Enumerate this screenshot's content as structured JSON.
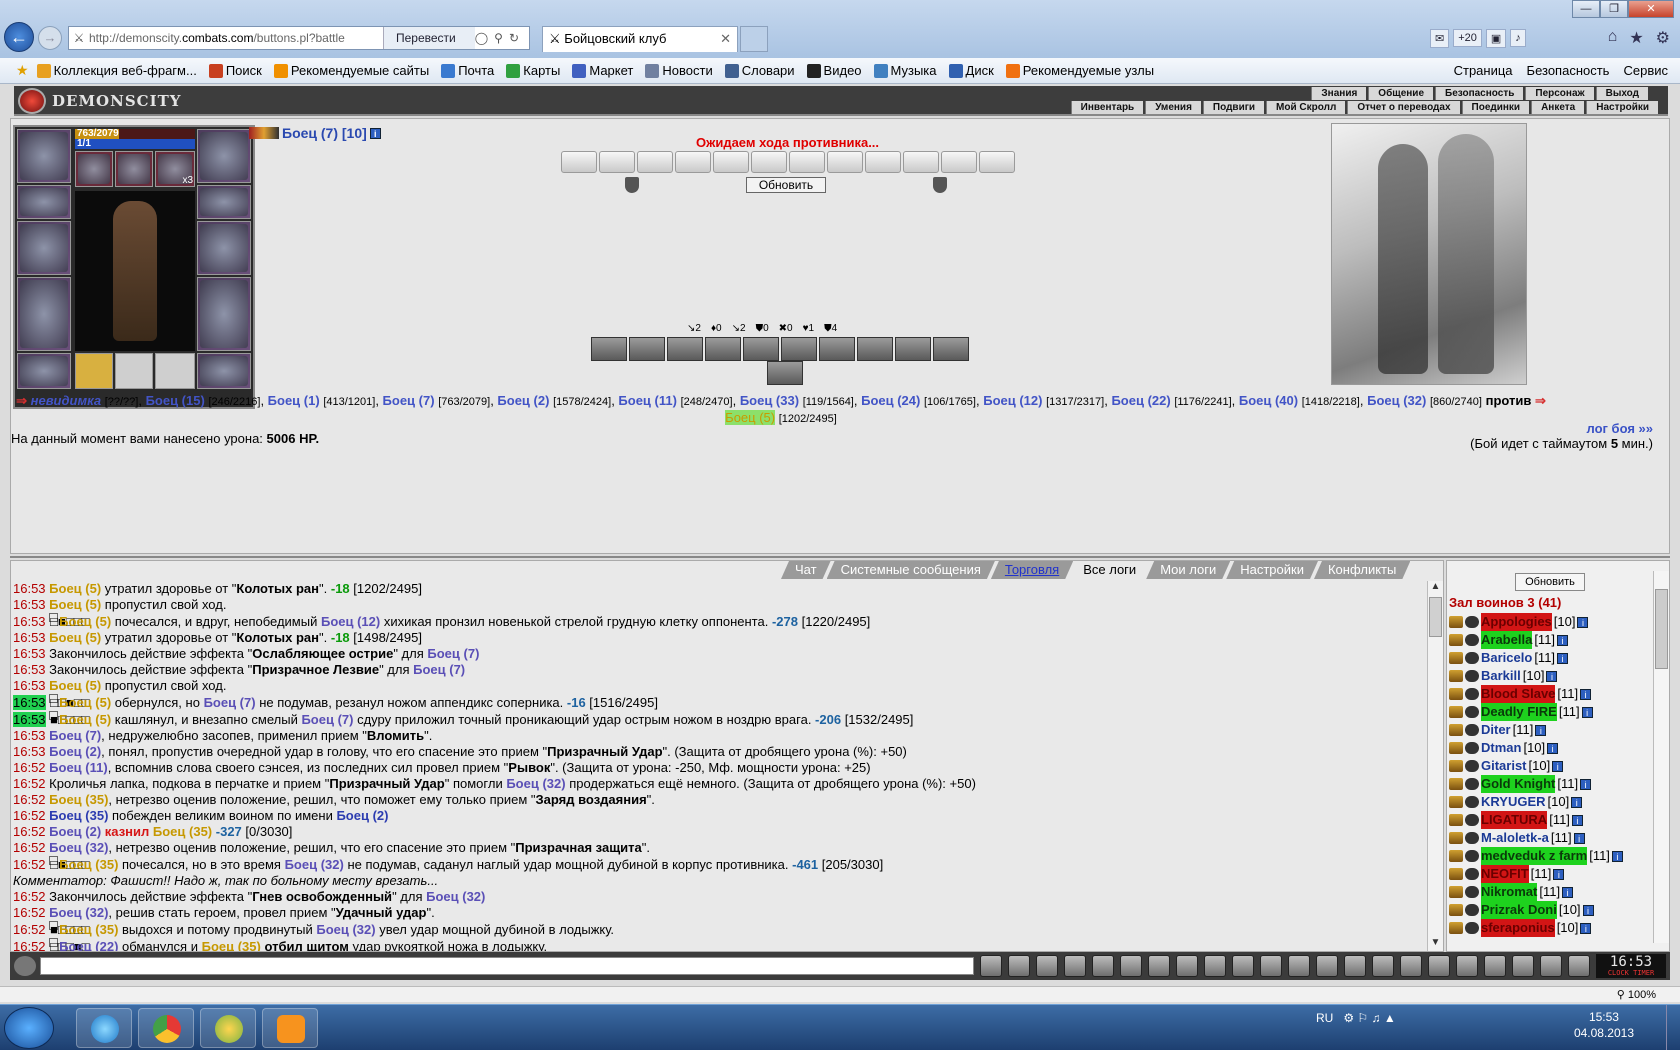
{
  "browser": {
    "url_prefix": "http://demonscity.",
    "url_domain": "combats.com",
    "url_rest": "/buttons.pl?battle",
    "translate_label": "Перевести",
    "tab_title": "Бойцовский клуб",
    "weather": "+20",
    "win_min": "—",
    "win_max": "❐",
    "win_close": "✕",
    "zoom": "100%"
  },
  "favorites": {
    "items": [
      {
        "label": "Коллекция веб-фрагм...",
        "color": "#e8a020"
      },
      {
        "label": "Поиск",
        "color": "#c84020"
      },
      {
        "label": "Рекомендуемые сайты",
        "color": "#f09000"
      },
      {
        "label": "Почта",
        "color": "#3a7ad0"
      },
      {
        "label": "Карты",
        "color": "#30a040"
      },
      {
        "label": "Маркет",
        "color": "#4060c0"
      },
      {
        "label": "Новости",
        "color": "#7080a0"
      },
      {
        "label": "Словари",
        "color": "#406090"
      },
      {
        "label": "Видео",
        "color": "#222222"
      },
      {
        "label": "Музыка",
        "color": "#4080c0"
      },
      {
        "label": "Диск",
        "color": "#3060b0"
      },
      {
        "label": "Рекомендуемые узлы",
        "color": "#f07010"
      }
    ],
    "right_items": [
      "Страница",
      "Безопасность",
      "Сервис"
    ]
  },
  "game": {
    "logo_text": "DEMONSCITY",
    "menu_top": [
      "Знания",
      "Общение",
      "Безопасность",
      "Персонаж",
      "Выход"
    ],
    "menu_bottom": [
      "Инвентарь",
      "Умения",
      "Подвиги",
      "Мой Скролл",
      "Отчет о переводах",
      "Поединки",
      "Анкета",
      "Настройки"
    ]
  },
  "character": {
    "hp_text": "763/2079",
    "hp_fraction": 0.367,
    "mp_text": "1/1",
    "name": "Боец (7) [10]",
    "stack_count": "x3"
  },
  "battle": {
    "waiting_text": "Ожидаем хода противника...",
    "refresh_label": "Обновить",
    "stats": [
      "↘2",
      "♦0",
      "↘2",
      "⛊0",
      "✖0",
      "♥1",
      "⛊4"
    ],
    "team1_html_parts": [
      {
        "type": "inv",
        "text": "невидимка",
        "hp": "[??/??]"
      },
      {
        "type": "p",
        "text": "Боец (15)",
        "hp": "[246/2216]"
      },
      {
        "type": "p",
        "text": "Боец (1)",
        "hp": "[413/1201]"
      },
      {
        "type": "p",
        "text": "Боец (7)",
        "hp": "[763/2079]"
      },
      {
        "type": "p",
        "text": "Боец (2)",
        "hp": "[1578/2424]"
      },
      {
        "type": "p",
        "text": "Боец (11)",
        "hp": "[248/2470]"
      },
      {
        "type": "p",
        "text": "Боец (33)",
        "hp": "[119/1564]"
      },
      {
        "type": "p",
        "text": "Боец (24)",
        "hp": "[106/1765]"
      },
      {
        "type": "p",
        "text": "Боец (12)",
        "hp": "[1317/2317]"
      },
      {
        "type": "p",
        "text": "Боец (22)",
        "hp": "[1176/2241]"
      },
      {
        "type": "p",
        "text": "Боец (40)",
        "hp": "[1418/2218]"
      },
      {
        "type": "p",
        "text": "Боец (32)",
        "hp": "[860/2740]"
      }
    ],
    "vs_label": "против",
    "enemy": {
      "text": "Боец (5)",
      "hp": "[1202/2495]"
    },
    "damage_prefix": "На данный момент вами нанесено урона:",
    "damage_value": "5006 HP.",
    "log_link": "лог боя »»",
    "timeout_prefix": "(Бой идет с таймаутом ",
    "timeout_value": "5",
    "timeout_suffix": " мин.)"
  },
  "chat": {
    "tabs": [
      "Чат",
      "Системные сообщения",
      "Торговля",
      "Все логи",
      "Мои логи",
      "Настройки",
      "Конфликты"
    ],
    "active_tab": "Все логи",
    "lines": [
      [
        {
          "c": "t",
          "v": "16:53 "
        },
        {
          "c": "o",
          "v": "Боец (5)"
        },
        {
          "v": " утратил здоровье от \""
        },
        {
          "c": "b",
          "v": "Колотых ран"
        },
        {
          "v": "\". "
        },
        {
          "c": "g",
          "v": "-18"
        },
        {
          "v": " [1202/2495]"
        }
      ],
      [
        {
          "c": "t",
          "v": "16:53 "
        },
        {
          "c": "o",
          "v": "Боец (5)"
        },
        {
          "v": " пропустил свой ход."
        }
      ],
      [
        {
          "c": "t",
          "v": "16:53 "
        },
        {
          "c": "sq",
          "v": "□■□□□ "
        },
        {
          "c": "o",
          "v": "Боец (5)"
        },
        {
          "v": " почесался, и вдруг, непобедимый "
        },
        {
          "c": "n",
          "v": "Боец (12)"
        },
        {
          "v": " хихикая пронзил новенькой стрелой грудную клетку оппонента. "
        },
        {
          "c": "bl",
          "v": "-278"
        },
        {
          "v": " [1220/2495]"
        }
      ],
      [
        {
          "c": "t",
          "v": "16:53 "
        },
        {
          "c": "o",
          "v": "Боец (5)"
        },
        {
          "v": " утратил здоровье от \""
        },
        {
          "c": "b",
          "v": "Колотых ран"
        },
        {
          "v": "\". "
        },
        {
          "c": "g",
          "v": "-18"
        },
        {
          "v": " [1498/2495]"
        }
      ],
      [
        {
          "c": "t",
          "v": "16:53 "
        },
        {
          "v": "Закончилось действие эффекта \""
        },
        {
          "c": "b",
          "v": "Ослабляющее острие"
        },
        {
          "v": "\" для "
        },
        {
          "c": "n",
          "v": "Боец (7)"
        }
      ],
      [
        {
          "c": "t",
          "v": "16:53 "
        },
        {
          "v": "Закончилось действие эффекта \""
        },
        {
          "c": "b",
          "v": "Призрачное Лезвие"
        },
        {
          "v": "\" для "
        },
        {
          "c": "n",
          "v": "Боец (7)"
        }
      ],
      [
        {
          "c": "t",
          "v": "16:53 "
        },
        {
          "c": "o",
          "v": "Боец (5)"
        },
        {
          "v": " пропустил свой ход."
        }
      ],
      [
        {
          "c": "tg",
          "v": "16:53"
        },
        {
          "v": " "
        },
        {
          "c": "sq",
          "v": "□□■□□ "
        },
        {
          "c": "o",
          "v": "Боец (5)"
        },
        {
          "v": " обернулся, но "
        },
        {
          "c": "n",
          "v": "Боец (7)"
        },
        {
          "v": " не подумав, резанул ножом аппендикс соперника. "
        },
        {
          "c": "bl",
          "v": "-16"
        },
        {
          "v": " [1516/2495]"
        }
      ],
      [
        {
          "c": "tg",
          "v": "16:53"
        },
        {
          "v": " "
        },
        {
          "c": "sq",
          "v": "■□□□□ "
        },
        {
          "c": "o",
          "v": "Боец (5)"
        },
        {
          "v": " кашлянул, и внезапно смелый "
        },
        {
          "c": "n",
          "v": "Боец (7)"
        },
        {
          "v": " сдуру приложил точный проникающий удар острым ножом в ноздрю врага. "
        },
        {
          "c": "bl",
          "v": "-206"
        },
        {
          "v": " [1532/2495]"
        }
      ],
      [
        {
          "c": "t",
          "v": "16:53 "
        },
        {
          "c": "n",
          "v": "Боец (7)"
        },
        {
          "v": ", недружелюбно засопев, применил прием \""
        },
        {
          "c": "b",
          "v": "Вломить"
        },
        {
          "v": "\"."
        }
      ],
      [
        {
          "c": "t",
          "v": "16:53 "
        },
        {
          "c": "n",
          "v": "Боец (2)"
        },
        {
          "v": ", понял, пропустив очередной удар в голову, что его спасение это прием \""
        },
        {
          "c": "b",
          "v": "Призрачный Удар"
        },
        {
          "v": "\". (Защита от дробящего урона (%): +50)"
        }
      ],
      [
        {
          "c": "t",
          "v": "16:52 "
        },
        {
          "c": "n",
          "v": "Боец (11)"
        },
        {
          "v": ", вспомнив слова своего сэнсея, из последних сил провел прием \""
        },
        {
          "c": "b",
          "v": "Рывок"
        },
        {
          "v": "\". (Защита от урона: -250, Мф. мощности урона: +25)"
        }
      ],
      [
        {
          "c": "t",
          "v": "16:52 "
        },
        {
          "v": "Кроличья лапка, подкова в перчатке и прием \""
        },
        {
          "c": "b",
          "v": "Призрачный Удар"
        },
        {
          "v": "\" помогли "
        },
        {
          "c": "n",
          "v": "Боец (32)"
        },
        {
          "v": " продержаться ещё немного. (Защита от дробящего урона (%): +50)"
        }
      ],
      [
        {
          "c": "t",
          "v": "16:52 "
        },
        {
          "c": "o",
          "v": "Боец (35)"
        },
        {
          "v": ", нетрезво оценив положение, решил, что поможет ему только прием \""
        },
        {
          "c": "b",
          "v": "Заряд воздаяния"
        },
        {
          "v": "\"."
        }
      ],
      [
        {
          "c": "t",
          "v": "16:52 "
        },
        {
          "c": "n2",
          "v": "Боец (35)"
        },
        {
          "v": " побежден великим воином по имени "
        },
        {
          "c": "n2",
          "v": "Боец (2)"
        }
      ],
      [
        {
          "c": "t",
          "v": "16:52 "
        },
        {
          "c": "n",
          "v": "Боец (2)"
        },
        {
          "v": " "
        },
        {
          "c": "red",
          "v": "казнил"
        },
        {
          "v": " "
        },
        {
          "c": "o",
          "v": "Боец (35)"
        },
        {
          "v": " "
        },
        {
          "c": "bl",
          "v": "-327"
        },
        {
          "v": " [0/3030]"
        }
      ],
      [
        {
          "c": "t",
          "v": "16:52 "
        },
        {
          "c": "n",
          "v": "Боец (32)"
        },
        {
          "v": ", нетрезво оценив положение, решил, что его спасение это прием \""
        },
        {
          "c": "b",
          "v": "Призрачная защита"
        },
        {
          "v": "\"."
        }
      ],
      [
        {
          "c": "t",
          "v": "16:52 "
        },
        {
          "c": "sq",
          "v": "□■□□□ "
        },
        {
          "c": "o",
          "v": "Боец (35)"
        },
        {
          "v": " почесался, но в это время "
        },
        {
          "c": "n",
          "v": "Боец (32)"
        },
        {
          "v": " не подумав, саданул наглый удар мощной дубиной в корпус противника. "
        },
        {
          "c": "bl",
          "v": "-461"
        },
        {
          "v": " [205/3030]"
        }
      ],
      [
        {
          "c": "it",
          "v": "Комментатор: Фашист!! Надо ж, так по больному месту врезать..."
        }
      ],
      [
        {
          "c": "t",
          "v": "16:52 "
        },
        {
          "v": "Закончилось действие эффекта \""
        },
        {
          "c": "b",
          "v": "Гнев освобожденный"
        },
        {
          "v": "\" для "
        },
        {
          "c": "n",
          "v": "Боец (32)"
        }
      ],
      [
        {
          "c": "t",
          "v": "16:52 "
        },
        {
          "c": "n",
          "v": "Боец (32)"
        },
        {
          "v": ", решив стать героем, провел прием \""
        },
        {
          "c": "b",
          "v": "Удачный удар"
        },
        {
          "v": "\"."
        }
      ],
      [
        {
          "c": "t",
          "v": "16:52 "
        },
        {
          "c": "sq",
          "v": "■□□□□ "
        },
        {
          "c": "o",
          "v": "Боец (35)"
        },
        {
          "v": " выдохся и потому продвинутый "
        },
        {
          "c": "n",
          "v": "Боец (32)"
        },
        {
          "v": " увел удар мощной дубиной в лодыжку."
        }
      ],
      [
        {
          "c": "t",
          "v": "16:52 "
        },
        {
          "c": "sq",
          "v": "□□□■□ "
        },
        {
          "c": "n",
          "v": "Боец (22)"
        },
        {
          "v": " обманулся и "
        },
        {
          "c": "o",
          "v": "Боец (35)"
        },
        {
          "v": " "
        },
        {
          "c": "b",
          "v": "отбил щитом"
        },
        {
          "v": " удар рукояткой ножа в лодыжку."
        }
      ]
    ]
  },
  "warriors": {
    "refresh_label": "Обновить",
    "title": "Зал воинов 3 (41)",
    "list": [
      {
        "name": "Appologies",
        "level": "[10]",
        "hl": "r"
      },
      {
        "name": "Arabella",
        "level": "[11]",
        "hl": "gr"
      },
      {
        "name": "Baricelo",
        "level": "[11]",
        "hl": ""
      },
      {
        "name": "Barkill",
        "level": "[10]",
        "hl": ""
      },
      {
        "name": "Blood Slave",
        "level": "[11]",
        "hl": "r"
      },
      {
        "name": "Deadly FIRE",
        "level": "[11]",
        "hl": "gr"
      },
      {
        "name": "Diter",
        "level": "[11]",
        "hl": ""
      },
      {
        "name": "Dtman",
        "level": "[10]",
        "hl": ""
      },
      {
        "name": "Gitarist",
        "level": "[10]",
        "hl": ""
      },
      {
        "name": "Gold Knight",
        "level": "[11]",
        "hl": "gr"
      },
      {
        "name": "KRYUGER",
        "level": "[10]",
        "hl": ""
      },
      {
        "name": "LIGATURA",
        "level": "[11]",
        "hl": "r"
      },
      {
        "name": "M-aloletk-a",
        "level": "[11]",
        "hl": ""
      },
      {
        "name": "medveduk z farm",
        "level": "[11]",
        "hl": "gr"
      },
      {
        "name": "NEOFIT",
        "level": "[11]",
        "hl": "r"
      },
      {
        "name": "Nikromat",
        "level": "[11]",
        "hl": "gr"
      },
      {
        "name": "Prizrak Doni",
        "level": "[10]",
        "hl": "gr"
      },
      {
        "name": "sferaponius",
        "level": "[10]",
        "hl": "r"
      }
    ]
  },
  "clock": {
    "time": "16:53",
    "sub": "CLOCK TIMER"
  },
  "taskbar": {
    "lang": "RU",
    "time": "15:53",
    "date": "04.08.2013"
  }
}
